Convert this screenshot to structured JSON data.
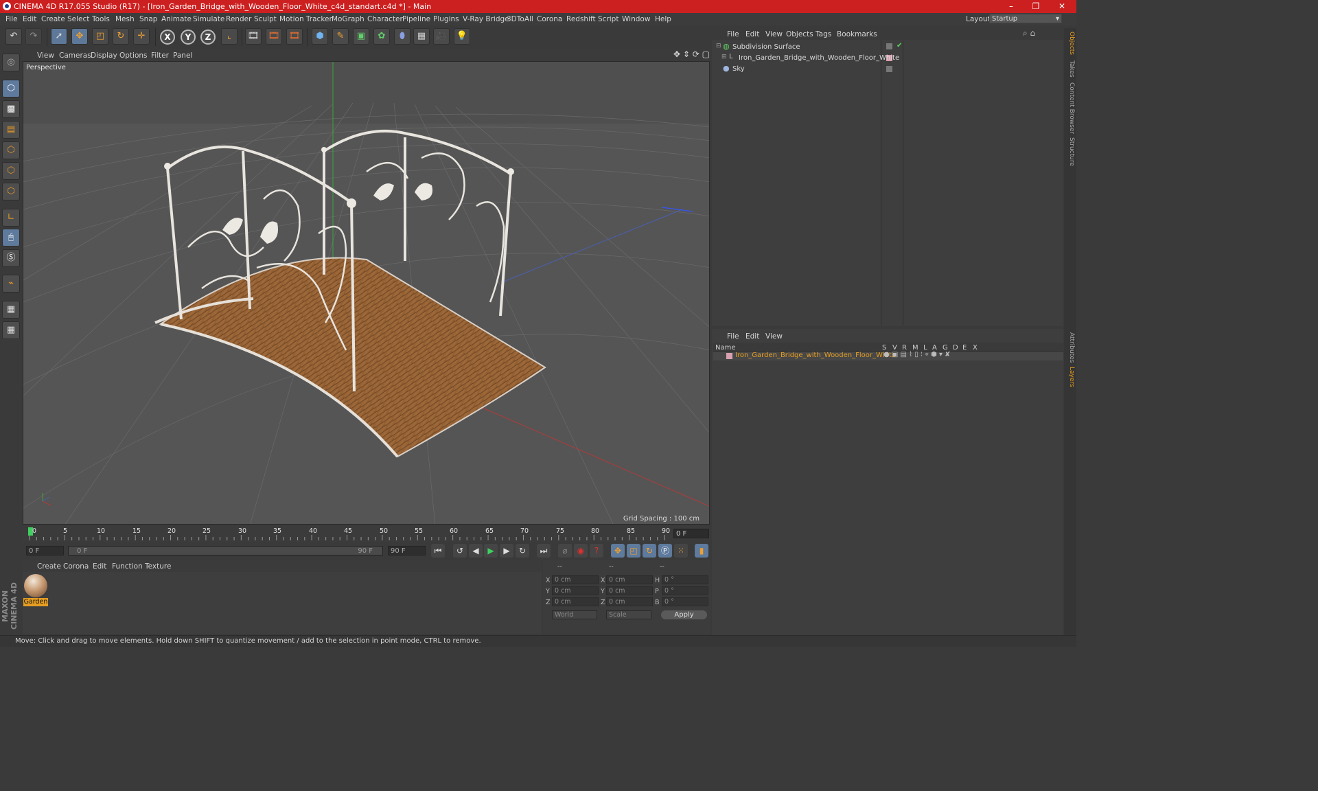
{
  "window": {
    "title": "CINEMA 4D R17.055 Studio (R17) - [Iron_Garden_Bridge_with_Wooden_Floor_White_c4d_standart.c4d *] - Main",
    "controls": [
      "–",
      "❐",
      "✕"
    ]
  },
  "menubar": {
    "items": [
      "File",
      "Edit",
      "Create",
      "Select",
      "Tools",
      "Mesh",
      "Snap",
      "Animate",
      "Simulate",
      "Render",
      "Sculpt",
      "Motion Tracker",
      "MoGraph",
      "Character",
      "Pipeline",
      "Plugins",
      "V-Ray Bridge",
      "3DToAll",
      "Corona",
      "Redshift",
      "Script",
      "Window",
      "Help"
    ],
    "layout_label": "Layout:",
    "layout_value": "Startup"
  },
  "toolbar": {
    "axis_x": "X",
    "axis_y": "Y",
    "axis_z": "Z"
  },
  "viewport": {
    "menu": [
      "View",
      "Cameras",
      "Display",
      "Options",
      "Filter",
      "Panel"
    ],
    "camera_label": "Perspective",
    "grid_spacing": "Grid Spacing : 100 cm"
  },
  "timeline": {
    "ticks": [
      "0",
      "5",
      "10",
      "15",
      "20",
      "25",
      "30",
      "35",
      "40",
      "45",
      "50",
      "55",
      "60",
      "65",
      "70",
      "75",
      "80",
      "85",
      "90"
    ],
    "current_frame": "0 F",
    "start_field": "0 F",
    "range_start": "0 F",
    "range_end": "90 F",
    "end_field": "90 F"
  },
  "materials": {
    "menu": [
      "Create",
      "Corona",
      "Edit",
      "Function",
      "Texture"
    ],
    "items": [
      {
        "name": "Garden"
      }
    ]
  },
  "coordinates": {
    "header": [
      "--",
      "--",
      "--"
    ],
    "rows": [
      {
        "l1": "X",
        "v1": "0 cm",
        "l2": "X",
        "v2": "0 cm",
        "l3": "H",
        "v3": "0 °"
      },
      {
        "l1": "Y",
        "v1": "0 cm",
        "l2": "Y",
        "v2": "0 cm",
        "l3": "P",
        "v3": "0 °"
      },
      {
        "l1": "Z",
        "v1": "0 cm",
        "l2": "Z",
        "v2": "0 cm",
        "l3": "B",
        "v3": "0 °"
      }
    ],
    "mode_world": "World",
    "mode_scale": "Scale",
    "apply": "Apply"
  },
  "objects": {
    "menu": [
      "File",
      "Edit",
      "View",
      "Objects",
      "Tags",
      "Bookmarks"
    ],
    "items": [
      {
        "name": "Subdivision Surface"
      },
      {
        "name": "Iron_Garden_Bridge_with_Wooden_Floor_White"
      },
      {
        "name": "Sky"
      }
    ]
  },
  "layers": {
    "menu": [
      "File",
      "Edit",
      "View"
    ],
    "header_name": "Name",
    "columns": [
      "S",
      "V",
      "R",
      "M",
      "L",
      "A",
      "G",
      "D",
      "E",
      "X"
    ],
    "items": [
      {
        "name": "Iron_Garden_Bridge_with_Wooden_Floor_White",
        "color": "#e59e22"
      }
    ]
  },
  "side_tabs": [
    "Objects",
    "Takes",
    "Content Browser",
    "Structure",
    "Attributes",
    "Layers"
  ],
  "status": "Move: Click and drag to move elements. Hold down SHIFT to quantize movement / add to the selection in point mode, CTRL to remove.",
  "brand": "MAXON CINEMA 4D"
}
